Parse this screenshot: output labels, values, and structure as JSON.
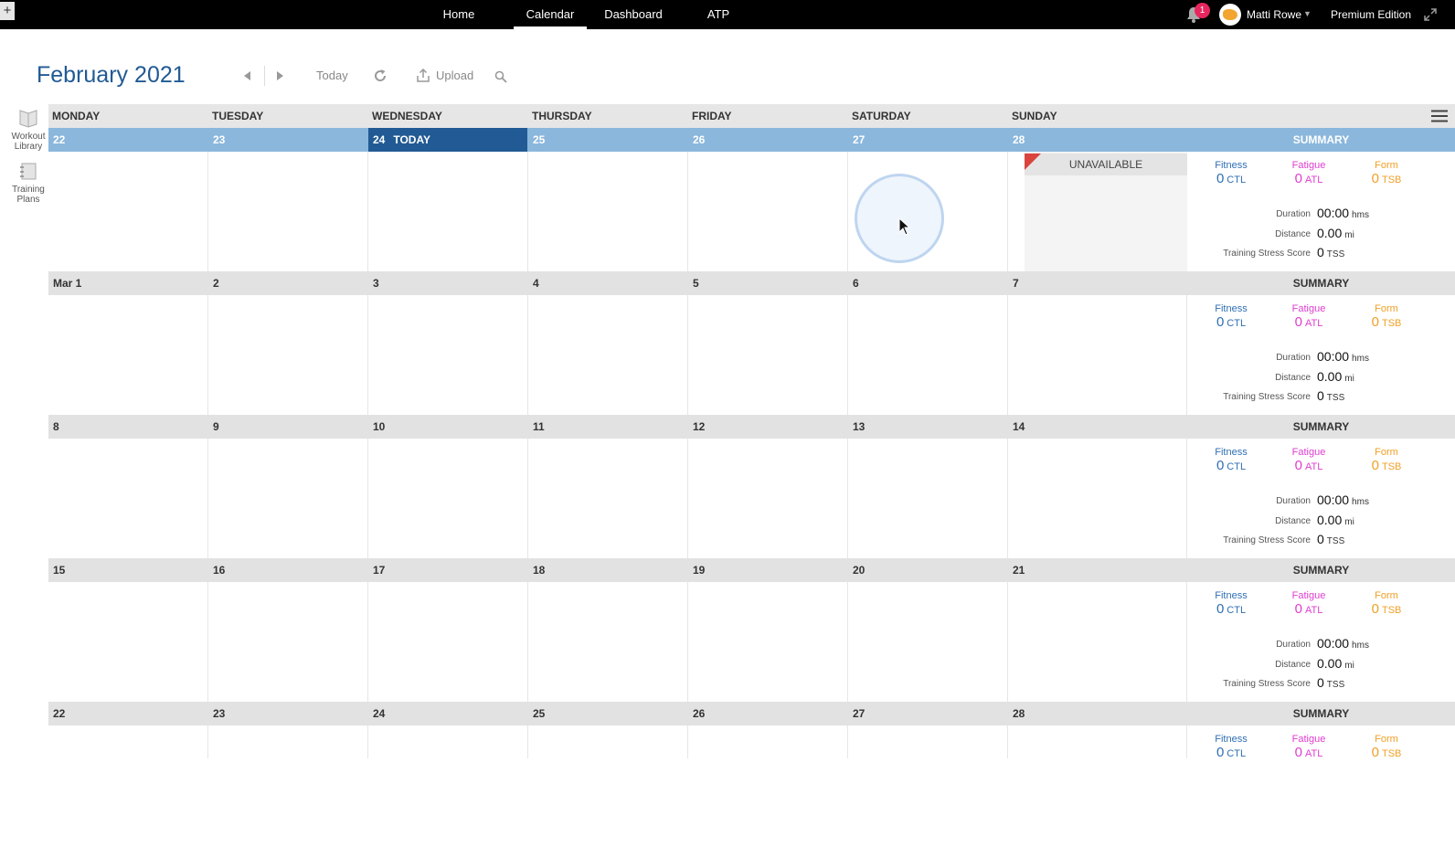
{
  "topbar": {
    "corner_button": "+",
    "nav": [
      "Home",
      "Calendar",
      "Dashboard",
      "ATP"
    ],
    "active_nav": "Calendar",
    "notifications_count": "1",
    "user_name": "Matti Rowe",
    "edition": "Premium Edition"
  },
  "header": {
    "month": "February",
    "year": "2021",
    "today_button": "Today",
    "upload_button": "Upload"
  },
  "rail": {
    "workout_library": [
      "Workout",
      "Library"
    ],
    "training_plans": [
      "Training",
      "Plans"
    ]
  },
  "calendar": {
    "weekdays": [
      "MONDAY",
      "TUESDAY",
      "WEDNESDAY",
      "THURSDAY",
      "FRIDAY",
      "SATURDAY",
      "SUNDAY"
    ],
    "today_label": "TODAY",
    "unavailable_label": "UNAVAILABLE",
    "summary_label": "SUMMARY",
    "weeks": [
      {
        "days": [
          "22",
          "23",
          "24",
          "25",
          "26",
          "27",
          "28"
        ]
      },
      {
        "days": [
          "Mar 1",
          "2",
          "3",
          "4",
          "5",
          "6",
          "7"
        ]
      },
      {
        "days": [
          "8",
          "9",
          "10",
          "11",
          "12",
          "13",
          "14"
        ]
      },
      {
        "days": [
          "15",
          "16",
          "17",
          "18",
          "19",
          "20",
          "21"
        ]
      },
      {
        "days": [
          "22",
          "23",
          "24",
          "25",
          "26",
          "27",
          "28"
        ]
      }
    ]
  },
  "summary": {
    "fitness_label": "Fitness",
    "fitness_value": "0",
    "fitness_unit": "CTL",
    "fatigue_label": "Fatigue",
    "fatigue_value": "0",
    "fatigue_unit": "ATL",
    "form_label": "Form",
    "form_value": "0",
    "form_unit": "TSB",
    "duration_label": "Duration",
    "duration_value": "00:00",
    "duration_unit": "hms",
    "distance_label": "Distance",
    "distance_value": "0.00",
    "distance_unit": "mi",
    "tss_label": "Training Stress Score",
    "tss_value": "0",
    "tss_unit": "TSS"
  },
  "colors": {
    "topbar": "#000000",
    "brand_blue": "#215a94",
    "current_week_strip": "#8bb7dc",
    "fitness": "#2f6fb3",
    "fatigue": "#e03dd0",
    "form": "#f0a027",
    "badge": "#e8265e",
    "unavailable_flag": "#d9443d"
  }
}
